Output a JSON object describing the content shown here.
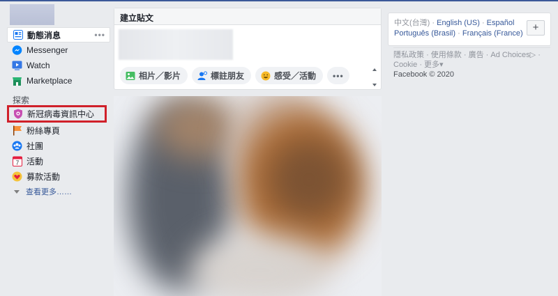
{
  "nav": {
    "items": [
      {
        "label": "動態消息",
        "icon": "news-feed-icon"
      },
      {
        "label": "Messenger",
        "icon": "messenger-icon"
      },
      {
        "label": "Watch",
        "icon": "watch-icon"
      },
      {
        "label": "Marketplace",
        "icon": "marketplace-icon"
      }
    ],
    "more_dots": "•••",
    "explore_heading": "探索",
    "explore_items": [
      {
        "label": "新冠病毒資訊中心",
        "icon": "covid-shield-icon"
      },
      {
        "label": "粉絲專頁",
        "icon": "flag-icon"
      },
      {
        "label": "社團",
        "icon": "groups-icon"
      },
      {
        "label": "活動",
        "icon": "calendar-icon",
        "badge": "7"
      },
      {
        "label": "募款活動",
        "icon": "fundraiser-icon"
      }
    ],
    "see_more": "查看更多……"
  },
  "composer": {
    "title": "建立貼文",
    "actions": [
      {
        "label": "相片／影片",
        "icon": "photo-icon"
      },
      {
        "label": "標註朋友",
        "icon": "tag-friends-icon"
      },
      {
        "label": "感受／活動",
        "icon": "feeling-icon"
      }
    ],
    "more": "•••"
  },
  "languages": {
    "current": "中文(台灣)",
    "links": [
      "English (US)",
      "Español",
      "Português (Brasil)",
      "Français (France)"
    ],
    "separator": "·",
    "add_label": "+"
  },
  "footer": {
    "links": [
      "隱私政策",
      "使用條款",
      "廣告",
      "Ad Choices",
      "Cookie",
      "更多"
    ],
    "separator": "·",
    "copyright": "Facebook © 2020"
  },
  "colors": {
    "brand": "#3b5998",
    "link": "#365899",
    "highlight": "#d0202a"
  }
}
